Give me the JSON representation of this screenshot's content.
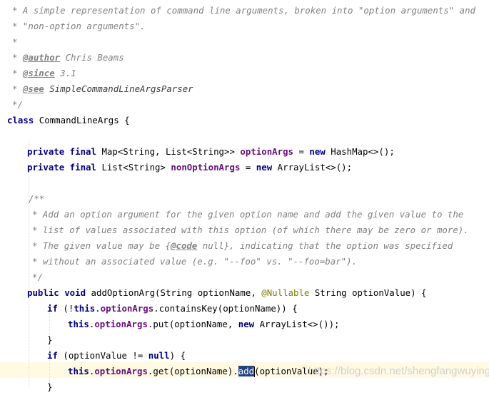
{
  "code": {
    "doc1": {
      "l1": "* A simple representation of command line arguments, broken into \"option arguments\" and",
      "l2": "* \"non-option arguments\".",
      "l3": "*",
      "author_tag": "@author",
      "author_val": " Chris Beams",
      "since_tag": "@since",
      "since_val": " 3.1",
      "see_tag": "@see",
      "see_val": " SimpleCommandLineArgsParser",
      "close": "*/"
    },
    "class_decl": {
      "kw": "class",
      "name": " CommandLineArgs {"
    },
    "field1": {
      "kw": "private final",
      "type": " Map<String, List<String>> ",
      "name": "optionArgs",
      "eq": " = ",
      "new_kw": "new",
      "rest": " HashMap<>();"
    },
    "field2": {
      "kw": "private final",
      "type": " List<String> ",
      "name": "nonOptionArgs",
      "eq": " = ",
      "new_kw": "new",
      "rest": " ArrayList<>();"
    },
    "doc2": {
      "open": "/**",
      "l1": "* Add an option argument for the given option name and add the given value to the",
      "l2": "* list of values associated with this option (of which there may be zero or more).",
      "l3_pre": "* The given value may be {",
      "l3_tag": "@code",
      "l3_post": " null}, indicating that the option was specified",
      "l4": "* without an associated value (e.g. \"--foo\" vs. \"--foo=bar\").",
      "close": "*/"
    },
    "method_decl": {
      "kw": "public void",
      "sig": " addOptionArg(String optionName, ",
      "ann": "@Nullable",
      "rest": " String optionValue) {"
    },
    "if1": {
      "kw": "if",
      "pre": " (!",
      "this_kw": "this",
      "dot": ".",
      "field": "optionArgs",
      "rest": ".containsKey(optionName)) {"
    },
    "put": {
      "this_kw": "this",
      "dot": ".",
      "field": "optionArgs",
      "mid": ".put(optionName, ",
      "new_kw": "new",
      "rest": " ArrayList<>());"
    },
    "brace1": "}",
    "if2": {
      "kw": "if",
      "pre": " (optionValue != ",
      "null_kw": "null",
      "rest": ") {"
    },
    "get": {
      "this_kw": "this",
      "dot": ".",
      "field": "optionArgs",
      "mid": ".get(optionName).",
      "selected": "add",
      "rest": "(optionValue);"
    },
    "brace2": "}"
  },
  "watermark": "https://blog.csdn.net/shengfangwuying"
}
